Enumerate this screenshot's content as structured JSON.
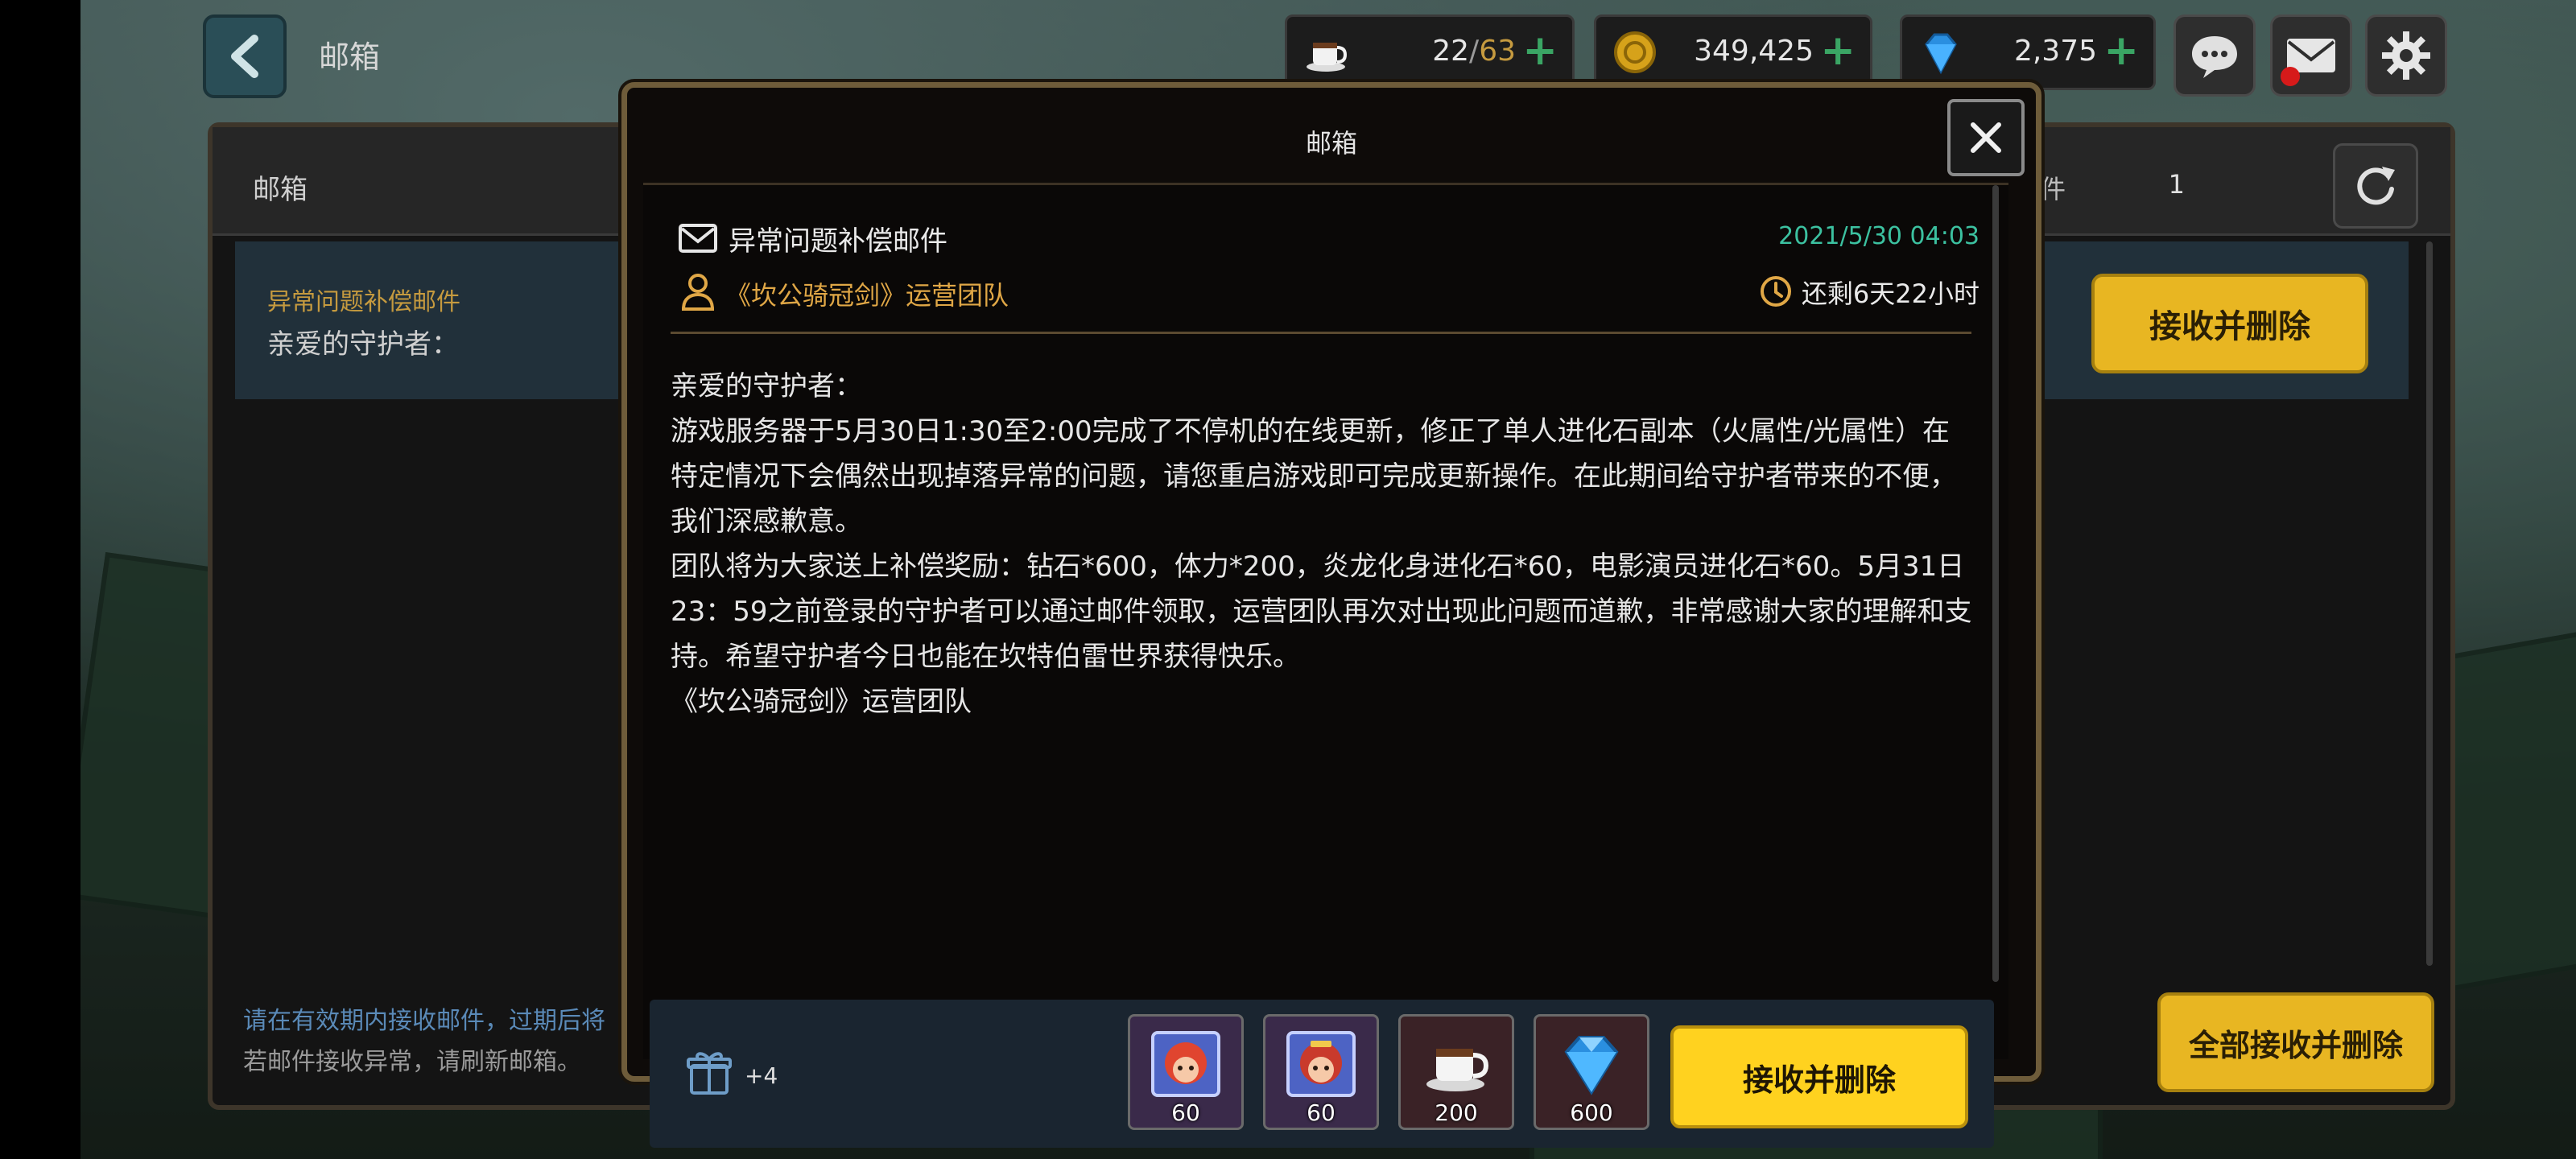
{
  "topbar": {
    "title": "邮箱",
    "stamina": {
      "current": "22",
      "max": "63"
    },
    "gold": "349,425",
    "gems": "2,375"
  },
  "panel": {
    "title": "邮箱",
    "favorites_label": "收藏的邮件",
    "favorites_count": "1",
    "mail_item": {
      "subject": "异常问题补偿邮件",
      "preview": "亲爱的守护者："
    },
    "list_receive_label": "接收并删除",
    "footer_note_1": "请在有效期内接收邮件，过期后将",
    "footer_note_2": "若邮件接收异常，请刷新邮箱。",
    "receive_all_label": "全部接收并删除"
  },
  "modal": {
    "title": "邮箱",
    "subject": "异常问题补偿邮件",
    "date": "2021/5/30 04:03",
    "sender": "《坎公骑冠剑》运营团队",
    "remaining": "还剩6天22小时",
    "body": [
      "亲爱的守护者：",
      "游戏服务器于5月30日1:30至2:00完成了不停机的在线更新，修正了单人进化石副本（火属性/光属性）在特定情况下会偶然出现掉落异常的问题，请您重启游戏即可完成更新操作。在此期间给守护者带来的不便，我们深感歉意。",
      "团队将为大家送上补偿奖励：钻石*600，体力*200，炎龙化身进化石*60，电影演员进化石*60。5月31日23：59之前登录的守护者可以通过邮件领取，运营团队再次对出现此问题而道歉，非常感谢大家的理解和支持。希望守护者今日也能在坎特伯雷世界获得快乐。",
      "《坎公骑冠剑》运营团队"
    ],
    "gift_count": "+4",
    "rewards": [
      {
        "icon": "hero-evolution-stone-icon",
        "count": "60"
      },
      {
        "icon": "hero-evolution-stone-icon",
        "count": "60"
      },
      {
        "icon": "coffee-cup-icon",
        "count": "200"
      },
      {
        "icon": "blue-diamond-icon",
        "count": "600"
      }
    ],
    "receive_label": "接收并删除"
  },
  "colors": {
    "accent_yellow": "#ffd21f",
    "date_teal": "#3cc1a0",
    "sender_orange": "#e0a746",
    "subject_orange": "#c59a3f"
  }
}
